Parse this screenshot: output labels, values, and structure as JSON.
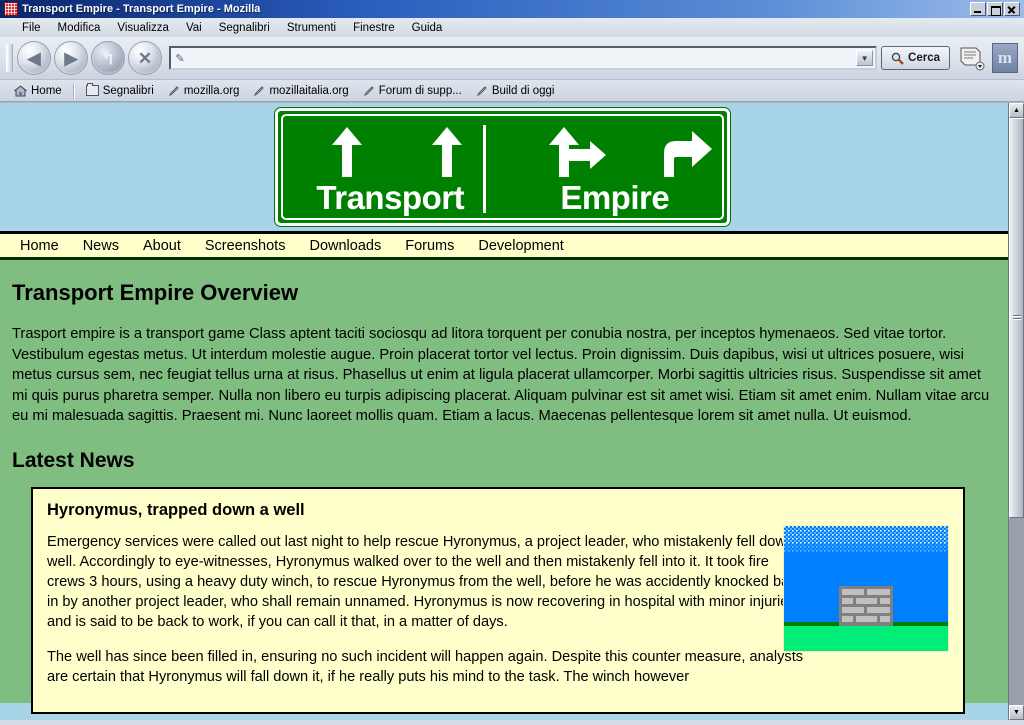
{
  "window": {
    "title": "Transport Empire - Transport Empire - Mozilla",
    "icon": "app-icon",
    "buttons": {
      "minimize": "_",
      "maximize": "□",
      "close": "✕"
    }
  },
  "menu": [
    {
      "label": "File"
    },
    {
      "label": "Modifica"
    },
    {
      "label": "Visualizza"
    },
    {
      "label": "Vai"
    },
    {
      "label": "Segnalibri"
    },
    {
      "label": "Strumenti"
    },
    {
      "label": "Finestre"
    },
    {
      "label": "Guida"
    }
  ],
  "toolbar": {
    "back": "◀",
    "forward": "▶",
    "reload": "↰",
    "stop": "✕",
    "url_value": "",
    "url_placeholder": "",
    "url_dropdown": "▼",
    "search_label": "Cerca",
    "search_icon": "search-icon",
    "print_icon": "print-icon",
    "print_dropdown": "▼",
    "mozilla_logo": "m"
  },
  "bookmarks": [
    {
      "label": "Home",
      "icon": "home-icon"
    },
    {
      "label": "Segnalibri",
      "icon": "folder-icon"
    },
    {
      "label": "mozilla.org",
      "icon": "bookmark-icon"
    },
    {
      "label": "mozillaitalia.org",
      "icon": "bookmark-icon"
    },
    {
      "label": "Forum di supp...",
      "icon": "bookmark-icon"
    },
    {
      "label": "Build di oggi",
      "icon": "bookmark-icon"
    }
  ],
  "page": {
    "banner": {
      "word_left": "Transport",
      "word_right": "Empire",
      "sign_color": "#008000",
      "text_color": "#ffffff"
    },
    "nav": [
      {
        "label": "Home"
      },
      {
        "label": "News"
      },
      {
        "label": "About"
      },
      {
        "label": "Screenshots"
      },
      {
        "label": "Downloads"
      },
      {
        "label": "Forums"
      },
      {
        "label": "Development"
      }
    ],
    "overview": {
      "heading": "Transport Empire Overview",
      "paragraph_1": "Trasport empire is a transport game Class aptent taciti sociosqu ad litora torquent per conubia nostra, per inceptos hymenaeos. Sed vitae tortor. Vestibulum egestas metus. Ut interdum molestie augue. Proin placerat tortor vel lectus. Proin dignissim. Duis dapibus, wisi ut ultrices posuere, wisi metus cursus sem, nec feugiat tellus urna at risus. Phasellus ut enim at ligula placerat ullamcorper. Morbi sagittis ultricies risus. Suspendisse sit amet mi quis purus pharetra semper. Nulla non libero eu turpis adipiscing placerat. Aliquam pulvinar est sit amet wisi. Etiam sit amet enim. Nullam vitae arcu eu mi malesuada sagittis. Praesent mi. Nunc laoreet mollis quam. Etiam a lacus. Maecenas pellentesque lorem sit amet nulla. Ut euismod."
    },
    "latest_news": {
      "heading": "Latest News",
      "article": {
        "title": "Hyronymus, trapped down a well",
        "paragraph_1": "Emergency services were called out last night to help rescue Hyronymus, a project leader, who mistakenly fell down a well. Accordingly to eye-witnesses, Hyronymus walked over to the well and then mistakenly fell into it. It took fire crews 3 hours, using a heavy duty winch, to rescue Hyronymus from the well, before he was accidently knocked back in by another project leader, who shall remain unnamed. Hyronymus is now recovering in hospital with minor injuries and is said to be back to work, if you can call it that, in a matter of days.",
        "paragraph_2": "The well has since been filled in, ensuring no such incident will happen again. Despite this counter measure, analysts are certain that Hyronymus will fall down it, if he really puts his mind to the task. The winch however",
        "image_alt": "well-illustration"
      }
    },
    "colors": {
      "header_bg": "#a8d4e8",
      "nav_bg": "#ffffcc",
      "content_bg": "#80bd80",
      "newsbox_bg": "#ffffcc"
    }
  },
  "scrollbar": {
    "up": "▲",
    "down": "▼"
  }
}
